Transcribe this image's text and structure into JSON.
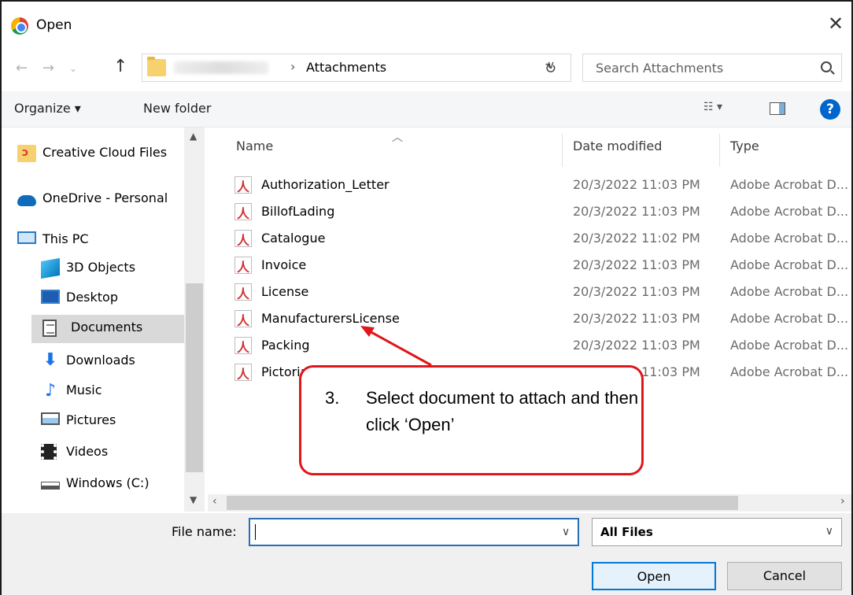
{
  "window": {
    "title": "Open",
    "close_icon": "close-icon"
  },
  "address": {
    "current_folder": "Attachments",
    "search_placeholder": "Search Attachments"
  },
  "toolbar": {
    "organize_label": "Organize ▾",
    "new_folder_label": "New folder",
    "help_label": "?"
  },
  "nav": {
    "items": [
      {
        "label": "Creative Cloud Files",
        "icon": "creative-cloud-folder-icon"
      },
      {
        "label": "OneDrive - Personal",
        "icon": "onedrive-icon"
      },
      {
        "label": "This PC",
        "icon": "computer-icon"
      },
      {
        "label": "3D Objects",
        "icon": "3d-objects-icon"
      },
      {
        "label": "Desktop",
        "icon": "desktop-icon"
      },
      {
        "label": "Documents",
        "icon": "documents-icon",
        "selected": true
      },
      {
        "label": "Downloads",
        "icon": "download-arrow-icon"
      },
      {
        "label": "Music",
        "icon": "music-note-icon"
      },
      {
        "label": "Pictures",
        "icon": "pictures-icon"
      },
      {
        "label": "Videos",
        "icon": "film-icon"
      },
      {
        "label": "Windows (C:)",
        "icon": "drive-icon"
      }
    ]
  },
  "files": {
    "columns": [
      "Name",
      "Date modified",
      "Type"
    ],
    "rows": [
      {
        "name": "Authorization_Letter",
        "date": "20/3/2022 11:03 PM",
        "type": "Adobe Acrobat D..."
      },
      {
        "name": "BillofLading",
        "date": "20/3/2022 11:03 PM",
        "type": "Adobe Acrobat D..."
      },
      {
        "name": "Catalogue",
        "date": "20/3/2022 11:02 PM",
        "type": "Adobe Acrobat D..."
      },
      {
        "name": "Invoice",
        "date": "20/3/2022 11:03 PM",
        "type": "Adobe Acrobat D..."
      },
      {
        "name": "License",
        "date": "20/3/2022 11:03 PM",
        "type": "Adobe Acrobat D..."
      },
      {
        "name": "ManufacturersLicense",
        "date": "20/3/2022 11:03 PM",
        "type": "Adobe Acrobat D..."
      },
      {
        "name": "Packing",
        "date": "20/3/2022 11:03 PM",
        "type": "Adobe Acrobat D..."
      },
      {
        "name": "Pictorial",
        "date": "20/3/2022 11:03 PM",
        "type": "Adobe Acrobat D..."
      }
    ]
  },
  "bottom": {
    "file_name_label": "File name:",
    "file_name_value": "",
    "file_type": "All Files",
    "open_label": "Open",
    "cancel_label": "Cancel"
  },
  "annotation": {
    "step": "3.",
    "text": "Select document to attach and then click ‘Open’",
    "color": "#e0161b"
  }
}
